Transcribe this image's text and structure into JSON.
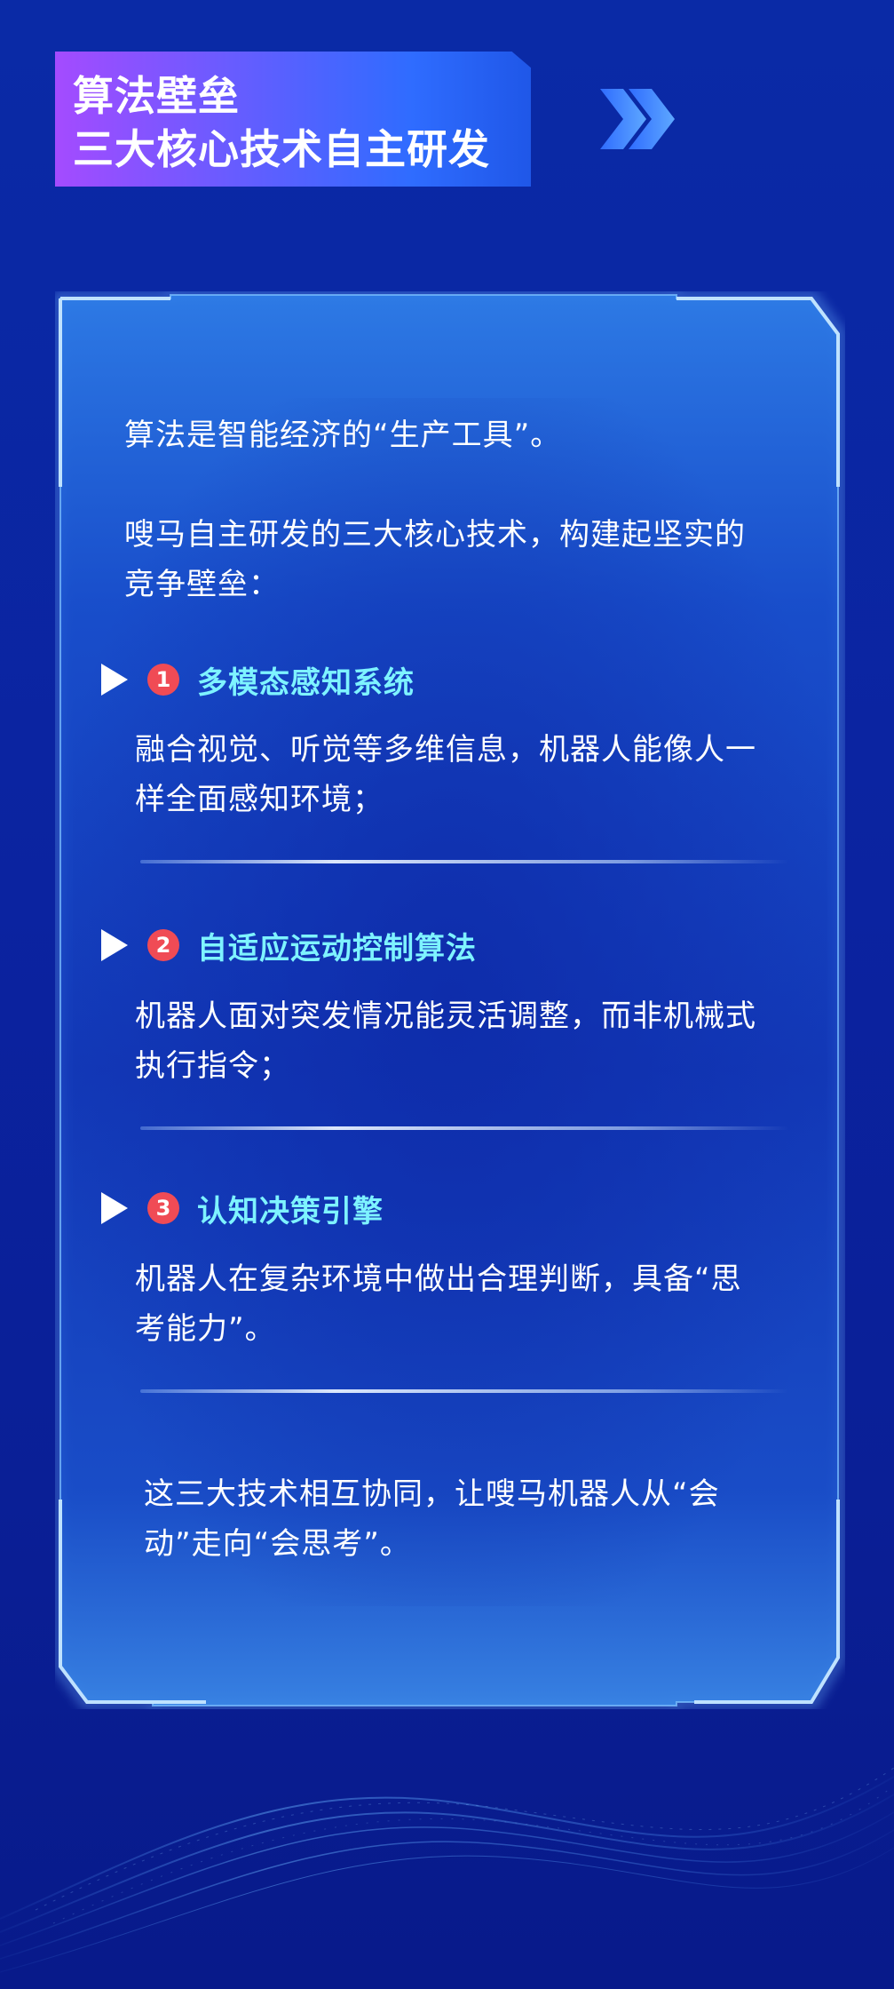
{
  "header": {
    "title_line1": "算法壁垒",
    "title_line2": "三大核心技术自主研发"
  },
  "intro": {
    "line1": "算法是智能经济的“生产工具”。",
    "line2a": "嗖马自主研发的三大核心技术，构建起坚实的",
    "line2b": "竞争壁垒："
  },
  "sections": [
    {
      "number": "1",
      "title": "多模态感知系统",
      "desc_line1": "融合视觉、听觉等多维信息，机器人能像人一",
      "desc_line2": "样全面感知环境；"
    },
    {
      "number": "2",
      "title": "自适应运动控制算法",
      "desc_line1": "机器人面对突发情况能灵活调整，而非机械式",
      "desc_line2": "执行指令；"
    },
    {
      "number": "3",
      "title": "认知决策引擎",
      "desc_line1": "机器人在复杂环境中做出合理判断，具备“思",
      "desc_line2": "考能力”。"
    }
  ],
  "closing": {
    "line1": "这三大技术相互协同，让嗖马机器人从“会",
    "line2": "动”走向“会思考”。"
  },
  "icons": {
    "header_decoration": "double-chevron-right-icon",
    "section_marker": "play-triangle-icon"
  },
  "colors": {
    "background": "#0a2aa6",
    "banner_start": "#a44bff",
    "banner_end": "#1f57e8",
    "section_title": "#7ef3ff",
    "number_badge": "#f04b55"
  }
}
